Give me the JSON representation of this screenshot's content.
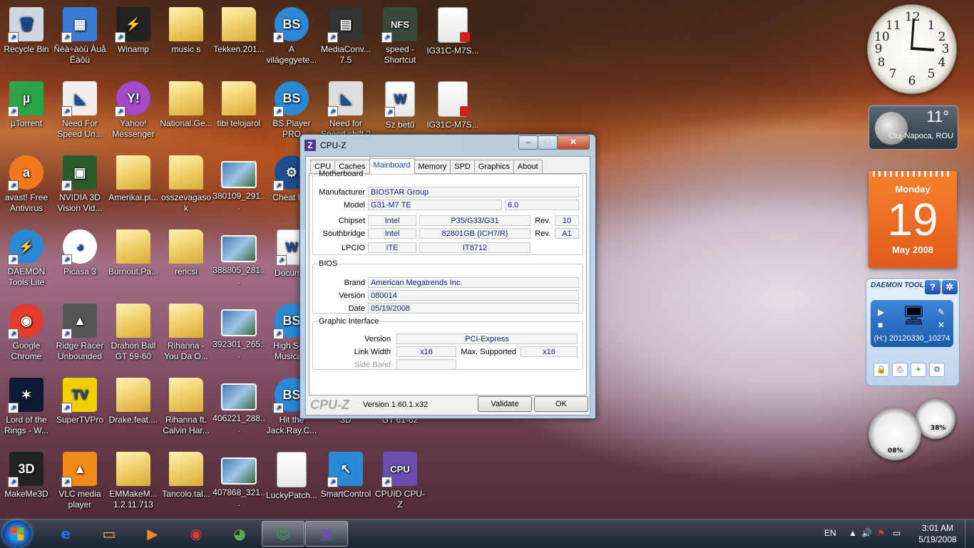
{
  "desktop_icons": [
    {
      "label": "Recycle Bin",
      "icon": "recycle-bin-icon",
      "glyph": "🗑",
      "kind": "plain",
      "col": 0,
      "row": 0,
      "bg": "#cfd8e0"
    },
    {
      "label": "Ñèà÷àòü Àuå Ëàôü",
      "icon": "app-shortcut-icon",
      "glyph": "▦",
      "kind": "plain",
      "col": 1,
      "row": 0,
      "bg": "#3a7bd5"
    },
    {
      "label": "Winamp",
      "icon": "winamp-icon",
      "glyph": "⚡",
      "kind": "plain",
      "col": 2,
      "row": 0,
      "bg": "#222"
    },
    {
      "label": "music s",
      "icon": "folder-icon",
      "glyph": "",
      "kind": "folder",
      "col": 3,
      "row": 0
    },
    {
      "label": "Tekken.201...",
      "icon": "folder-icon",
      "glyph": "",
      "kind": "folder",
      "col": 4,
      "row": 0
    },
    {
      "label": "A világegyete...",
      "icon": "bsplayer-icon",
      "glyph": "BS",
      "kind": "circle",
      "col": 5,
      "row": 0,
      "bg": "#2a8ad8"
    },
    {
      "label": "MediaConv... 7.5",
      "icon": "media-converter-icon",
      "glyph": "▤",
      "kind": "plain",
      "col": 6,
      "row": 0,
      "bg": "#333"
    },
    {
      "label": "speed - Shortcut",
      "icon": "nfs-icon",
      "glyph": "NFS",
      "kind": "plain",
      "col": 7,
      "row": 0,
      "bg": "#3a4a3a"
    },
    {
      "label": "IG31C-M7S...",
      "icon": "pdf-icon",
      "glyph": "",
      "kind": "doc",
      "col": 8,
      "row": 0
    },
    {
      "label": "µTorrent",
      "icon": "utorrent-icon",
      "glyph": "µ",
      "kind": "plain",
      "col": 0,
      "row": 1,
      "bg": "#2ea34a"
    },
    {
      "label": "Need For Speed Un...",
      "icon": "nfs-undercover-icon",
      "glyph": "◣",
      "kind": "plain",
      "col": 1,
      "row": 1,
      "bg": "#eee"
    },
    {
      "label": "Yahoo! Messenger",
      "icon": "yahoo-messenger-icon",
      "glyph": "Y!",
      "kind": "circle",
      "col": 2,
      "row": 1,
      "bg": "#a64ac9"
    },
    {
      "label": "National.Ge...",
      "icon": "folder-icon",
      "glyph": "",
      "kind": "folder",
      "col": 3,
      "row": 1
    },
    {
      "label": "tibi telojarol",
      "icon": "folder-icon",
      "glyph": "",
      "kind": "folder",
      "col": 4,
      "row": 1
    },
    {
      "label": "BS.Player PRO",
      "icon": "bsplayer-icon",
      "glyph": "BS",
      "kind": "circle",
      "col": 5,
      "row": 1,
      "bg": "#2a8ad8"
    },
    {
      "label": "Need for Speed shift 2",
      "icon": "nfs-shift-icon",
      "glyph": "◣",
      "kind": "plain",
      "col": 6,
      "row": 1,
      "bg": "#ddd"
    },
    {
      "label": "Sz betű",
      "icon": "word-doc-icon",
      "glyph": "W",
      "kind": "doc",
      "col": 7,
      "row": 1
    },
    {
      "label": "IG31C-M7S...",
      "icon": "pdf-icon",
      "glyph": "",
      "kind": "doc",
      "col": 8,
      "row": 1
    },
    {
      "label": "avast! Free Antivirus",
      "icon": "avast-icon",
      "glyph": "a",
      "kind": "circle",
      "col": 0,
      "row": 2,
      "bg": "#f07a1a"
    },
    {
      "label": "NVIDIA 3D Vision Vid...",
      "icon": "nvidia-3d-icon",
      "glyph": "▣",
      "kind": "plain",
      "col": 1,
      "row": 2,
      "bg": "#2b5a2b"
    },
    {
      "label": "Amerikai.pi...",
      "icon": "folder-icon",
      "glyph": "",
      "kind": "folder",
      "col": 2,
      "row": 2
    },
    {
      "label": "osszevagasok",
      "icon": "folder-icon",
      "glyph": "",
      "kind": "folder",
      "col": 3,
      "row": 2
    },
    {
      "label": "380109_291...",
      "icon": "image-file-icon",
      "glyph": "",
      "kind": "img",
      "col": 4,
      "row": 2
    },
    {
      "label": "Cheat E...",
      "icon": "cheat-engine-icon",
      "glyph": "⚙",
      "kind": "circle",
      "col": 5,
      "row": 2,
      "bg": "#1d4e8f"
    },
    {
      "label": "DAEMON Tools Lite",
      "icon": "daemon-tools-icon",
      "glyph": "⚡",
      "kind": "circle",
      "col": 0,
      "row": 3,
      "bg": "#2a8ad8"
    },
    {
      "label": "Picasa 3",
      "icon": "picasa-icon",
      "glyph": "◕",
      "kind": "circle",
      "col": 1,
      "row": 3,
      "bg": "#fff"
    },
    {
      "label": "Burnout.Pa...",
      "icon": "folder-icon",
      "glyph": "",
      "kind": "folder",
      "col": 2,
      "row": 3
    },
    {
      "label": "rencsi",
      "icon": "folder-icon",
      "glyph": "",
      "kind": "folder",
      "col": 3,
      "row": 3
    },
    {
      "label": "388805_281...",
      "icon": "image-file-icon",
      "glyph": "",
      "kind": "img",
      "col": 4,
      "row": 3
    },
    {
      "label": "Docum...",
      "icon": "word-doc-icon",
      "glyph": "W",
      "kind": "doc",
      "col": 5,
      "row": 3
    },
    {
      "label": "Google Chrome",
      "icon": "chrome-icon",
      "glyph": "◉",
      "kind": "circle",
      "col": 0,
      "row": 4,
      "bg": "#e33b2e"
    },
    {
      "label": "Ridge Racer Unbounded",
      "icon": "ridge-racer-icon",
      "glyph": "▲",
      "kind": "plain",
      "col": 1,
      "row": 4,
      "bg": "#555"
    },
    {
      "label": "Drahon Ball GT 59-60",
      "icon": "folder-icon",
      "glyph": "",
      "kind": "folder",
      "col": 2,
      "row": 4
    },
    {
      "label": "Rihanna - You Da O...",
      "icon": "folder-icon",
      "glyph": "",
      "kind": "folder",
      "col": 3,
      "row": 4
    },
    {
      "label": "392301_265...",
      "icon": "image-file-icon",
      "glyph": "",
      "kind": "img",
      "col": 4,
      "row": 4
    },
    {
      "label": "High Sc... Musica...",
      "icon": "bsplayer-icon",
      "glyph": "BS",
      "kind": "circle",
      "col": 5,
      "row": 4,
      "bg": "#2a8ad8"
    },
    {
      "label": "Lord of the Rings - W...",
      "icon": "lotr-icon",
      "glyph": "✶",
      "kind": "plain",
      "col": 0,
      "row": 5,
      "bg": "#0c1a36"
    },
    {
      "label": "SuperTVPro",
      "icon": "supertv-icon",
      "glyph": "TV",
      "kind": "plain",
      "col": 1,
      "row": 5,
      "bg": "#f0d000"
    },
    {
      "label": "Drake.feat....",
      "icon": "folder-icon",
      "glyph": "",
      "kind": "folder",
      "col": 2,
      "row": 5
    },
    {
      "label": "Rihanna ft. Calvin Har...",
      "icon": "folder-icon",
      "glyph": "",
      "kind": "folder",
      "col": 3,
      "row": 5
    },
    {
      "label": "406221_288...",
      "icon": "image-file-icon",
      "glyph": "",
      "kind": "img",
      "col": 4,
      "row": 5
    },
    {
      "label": "Hit the Jack.Ray.C...",
      "icon": "bsplayer-icon",
      "glyph": "BS",
      "kind": "circle",
      "col": 5,
      "row": 5,
      "bg": "#2a8ad8"
    },
    {
      "label": "3D",
      "icon": "folder-icon",
      "glyph": "",
      "kind": "folder",
      "col": 6,
      "row": 5
    },
    {
      "label": "GT 61-62",
      "icon": "folder-icon",
      "glyph": "",
      "kind": "folder",
      "col": 7,
      "row": 5
    },
    {
      "label": "MakeMe3D",
      "icon": "makeme3d-icon",
      "glyph": "3D",
      "kind": "plain",
      "col": 0,
      "row": 6,
      "bg": "#222"
    },
    {
      "label": "VLC media player",
      "icon": "vlc-icon",
      "glyph": "▲",
      "kind": "plain",
      "col": 1,
      "row": 6,
      "bg": "#f28a1b"
    },
    {
      "label": "EMMakeM... 1.2.11.713",
      "icon": "folder-icon",
      "glyph": "",
      "kind": "folder",
      "col": 2,
      "row": 6
    },
    {
      "label": "Tancolo.tal...",
      "icon": "folder-icon",
      "glyph": "",
      "kind": "folder",
      "col": 3,
      "row": 6
    },
    {
      "label": "407868_321...",
      "icon": "image-file-icon",
      "glyph": "",
      "kind": "img",
      "col": 4,
      "row": 6
    },
    {
      "label": "LuckyPatch...",
      "icon": "blank-file-icon",
      "glyph": "",
      "kind": "doc",
      "col": 5,
      "row": 6
    },
    {
      "label": "SmartControl",
      "icon": "smartcontrol-icon",
      "glyph": "↖",
      "kind": "plain",
      "col": 6,
      "row": 6,
      "bg": "#2a8ad8"
    },
    {
      "label": "CPUID CPU-Z",
      "icon": "cpuz-icon",
      "glyph": "CPU",
      "kind": "plain",
      "col": 7,
      "row": 6,
      "bg": "#6a4fb0"
    }
  ],
  "gadgets": {
    "weather": {
      "temp": "11°",
      "city": "Cluj-Napoca, ROU"
    },
    "calendar": {
      "weekday": "Monday",
      "day": "19",
      "month_year": "May 2008"
    },
    "daemon": {
      "logo": "DAEMON TOOLS",
      "help": "?",
      "drive": "(H:) 20120330_10274"
    },
    "meter": {
      "cpu": "08%",
      "mem": "38%"
    }
  },
  "cpuz": {
    "title": "CPU-Z",
    "tabs": [
      "CPU",
      "Caches",
      "Mainboard",
      "Memory",
      "SPD",
      "Graphics",
      "About"
    ],
    "active_tab": "Mainboard",
    "motherboard": {
      "legend": "Motherboard",
      "manufacturer_label": "Manufacturer",
      "manufacturer": "BIOSTAR Group",
      "model_label": "Model",
      "model": "G31-M7 TE",
      "model_rev": "6.0",
      "chipset_label": "Chipset",
      "chipset_vendor": "Intel",
      "chipset": "P35/G33/G31",
      "chipset_rev_label": "Rev.",
      "chipset_rev": "10",
      "south_label": "Southbridge",
      "south_vendor": "Intel",
      "south": "82801GB (ICH7/R)",
      "south_rev_label": "Rev.",
      "south_rev": "A1",
      "lpcio_label": "LPCIO",
      "lpcio_vendor": "ITE",
      "lpcio": "IT8712"
    },
    "bios": {
      "legend": "BIOS",
      "brand_label": "Brand",
      "brand": "American Megatrends Inc.",
      "version_label": "Version",
      "version": "080014",
      "date_label": "Date",
      "date": "05/19/2008"
    },
    "graphic": {
      "legend": "Graphic Interface",
      "version_label": "Version",
      "version": "PCI-Express",
      "link_label": "Link Width",
      "link": "x16",
      "max_label": "Max. Supported",
      "max": "x16",
      "side_label": "Side Band",
      "side": ""
    },
    "footer": {
      "logo": "CPU-Z",
      "version": "Version 1.60.1.x32",
      "validate": "Validate",
      "ok": "OK"
    }
  },
  "taskbar": {
    "buttons": [
      {
        "name": "ie-taskbar-button",
        "icon": "internet-explorer-icon",
        "glyph": "e",
        "color": "#1a73e8"
      },
      {
        "name": "explorer-taskbar-button",
        "icon": "folder-icon",
        "glyph": "▭",
        "color": "#f0c24e"
      },
      {
        "name": "media-player-taskbar-button",
        "icon": "media-player-icon",
        "glyph": "▶",
        "color": "#f08a1a"
      },
      {
        "name": "chrome-taskbar-button",
        "icon": "chrome-icon",
        "glyph": "◉",
        "color": "#e33b2e"
      },
      {
        "name": "picasa-taskbar-button",
        "icon": "picasa-icon",
        "glyph": "◕",
        "color": "#5ab04a"
      },
      {
        "name": "messenger-taskbar-button",
        "icon": "messenger-icon",
        "glyph": "☺",
        "color": "#3aa04a"
      },
      {
        "name": "cpuz-taskbar-button",
        "icon": "cpuz-icon",
        "glyph": "▣",
        "color": "#6a4fb0"
      }
    ],
    "lang": "EN",
    "time": "3:01 AM",
    "date": "5/19/2008"
  },
  "colors": {
    "accent": "#1a3ea8",
    "value_text": "#0b1f8a",
    "calendar": "#e8641f"
  }
}
